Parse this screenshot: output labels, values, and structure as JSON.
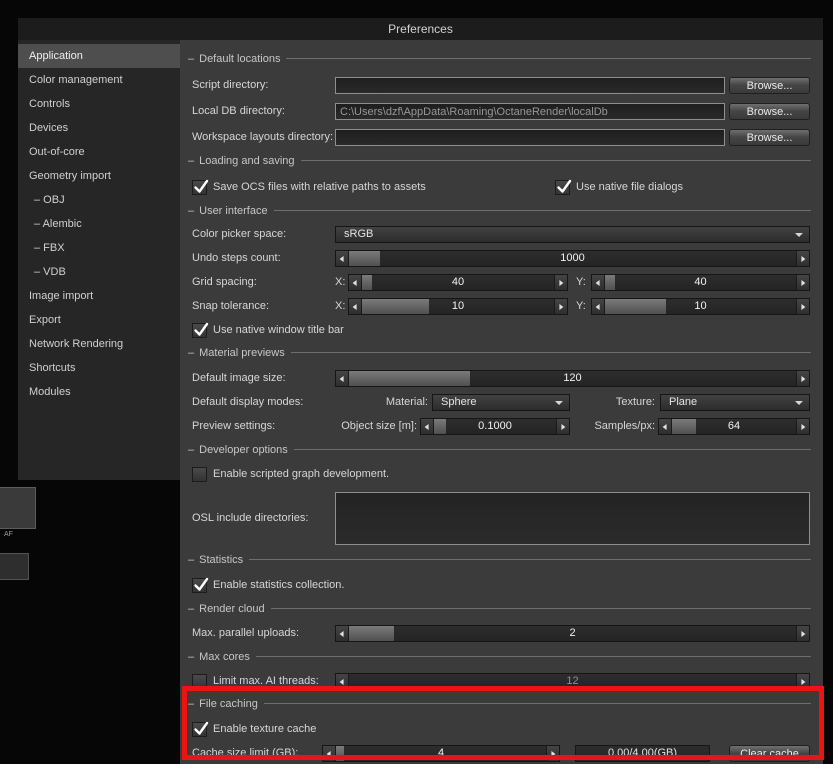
{
  "window": {
    "title": "Preferences"
  },
  "sidebar": {
    "items": [
      {
        "label": "Application",
        "selected": true
      },
      {
        "label": "Color management"
      },
      {
        "label": "Controls"
      },
      {
        "label": "Devices"
      },
      {
        "label": "Out-of-core"
      },
      {
        "label": "Geometry import"
      },
      {
        "label": "– OBJ"
      },
      {
        "label": "– Alembic"
      },
      {
        "label": "– FBX"
      },
      {
        "label": "– VDB"
      },
      {
        "label": "Image import"
      },
      {
        "label": "Export"
      },
      {
        "label": "Network Rendering"
      },
      {
        "label": "Shortcuts"
      },
      {
        "label": "Modules"
      }
    ]
  },
  "default_locations": {
    "title": "Default locations",
    "script_directory": {
      "label": "Script directory:",
      "value": "",
      "browse": "Browse..."
    },
    "local_db_directory": {
      "label": "Local DB directory:",
      "value": "C:\\Users\\dzf\\AppData\\Roaming\\OctaneRender\\localDb",
      "browse": "Browse..."
    },
    "workspace_layouts": {
      "label": "Workspace layouts directory:",
      "value": "",
      "browse": "Browse..."
    }
  },
  "loading_and_saving": {
    "title": "Loading and saving",
    "save_ocs": {
      "label": "Save OCS files with relative paths to assets",
      "checked": true
    },
    "native_dialogs": {
      "label": "Use native file dialogs",
      "checked": true
    }
  },
  "user_interface": {
    "title": "User interface",
    "color_picker": {
      "label": "Color picker space:",
      "value": "sRGB"
    },
    "undo_steps": {
      "label": "Undo steps count:",
      "value": "1000"
    },
    "grid_spacing": {
      "label": "Grid spacing:",
      "x_label": "X:",
      "x_value": "40",
      "y_label": "Y:",
      "y_value": "40"
    },
    "snap_tolerance": {
      "label": "Snap tolerance:",
      "x_label": "X:",
      "x_value": "10",
      "y_label": "Y:",
      "y_value": "10"
    },
    "native_title_bar": {
      "label": "Use native window title bar",
      "checked": true
    }
  },
  "material_previews": {
    "title": "Material previews",
    "default_image_size": {
      "label": "Default image size:",
      "value": "120"
    },
    "display_modes": {
      "label": "Default display modes:",
      "material_label": "Material:",
      "material_value": "Sphere",
      "texture_label": "Texture:",
      "texture_value": "Plane"
    },
    "preview_settings": {
      "label": "Preview settings:",
      "object_size_label": "Object size [m]:",
      "object_size_value": "0.1000",
      "samples_label": "Samples/px:",
      "samples_value": "64"
    }
  },
  "developer_options": {
    "title": "Developer options",
    "scripted_graph": {
      "label": "Enable scripted graph development.",
      "checked": false
    },
    "osl_include": {
      "label": "OSL include directories:",
      "value": ""
    }
  },
  "statistics": {
    "title": "Statistics",
    "collection": {
      "label": "Enable statistics collection.",
      "checked": true
    }
  },
  "render_cloud": {
    "title": "Render cloud",
    "max_parallel_uploads": {
      "label": "Max. parallel uploads:",
      "value": "2"
    }
  },
  "max_cores": {
    "title": "Max cores",
    "limit_ai_threads": {
      "label": "Limit max. AI threads:",
      "checked": false,
      "value": "12"
    }
  },
  "file_caching": {
    "title": "File caching",
    "enable_texture_cache": {
      "label": "Enable texture cache",
      "checked": true
    },
    "cache_size_limit": {
      "label": "Cache size limit (GB):",
      "value": "4",
      "usage": "0.00/4.00(GB)",
      "clear_button": "Clear cache"
    }
  },
  "background": {
    "node_label": "AF"
  },
  "colors": {
    "highlight_box": "#ec1313",
    "dialog_bg": "#3b3b3b",
    "sidebar_bg": "#262626"
  }
}
